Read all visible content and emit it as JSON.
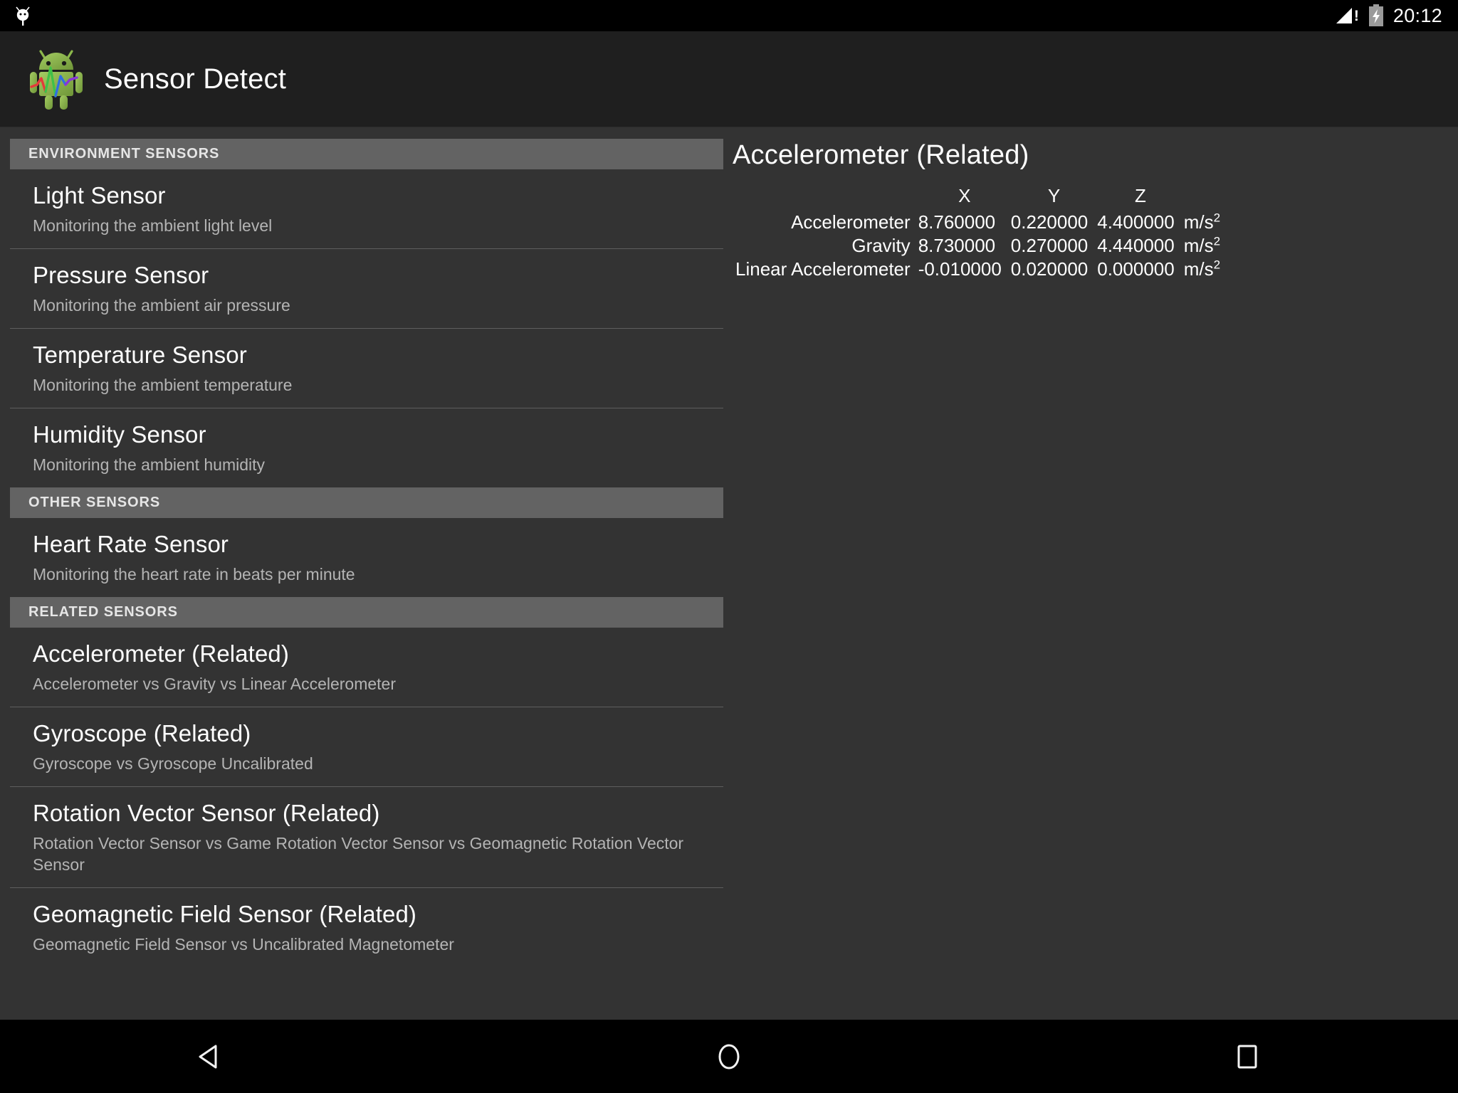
{
  "status_bar": {
    "notification_icon": "android-notification-icon",
    "signal_icon": "signal-bars-no-service-icon",
    "signal_alert": "!",
    "battery_icon": "battery-charging-icon",
    "time": "20:12"
  },
  "app_bar": {
    "icon": "android-sensor-logo-icon",
    "title": "Sensor Detect"
  },
  "colors": {
    "status_bar_bg": "#000000",
    "app_bar_bg": "#1f1f1f",
    "page_bg": "#333333",
    "section_header_bg": "#636363",
    "divider": "#5e5e5e",
    "primary_text": "#ffffff",
    "secondary_text": "#b4b4b4",
    "nav_bar_bg": "#000000",
    "robot_green": "#8cb84b"
  },
  "list": {
    "sections": [
      {
        "header": "ENVIRONMENT SENSORS",
        "items": [
          {
            "title": "Light Sensor",
            "subtitle": "Monitoring the ambient light level",
            "divider_after": true
          },
          {
            "title": "Pressure Sensor",
            "subtitle": "Monitoring the ambient air pressure",
            "divider_after": true
          },
          {
            "title": "Temperature Sensor",
            "subtitle": "Monitoring the ambient temperature",
            "divider_after": true
          },
          {
            "title": "Humidity Sensor",
            "subtitle": "Monitoring the ambient humidity",
            "divider_after": false
          }
        ]
      },
      {
        "header": "OTHER SENSORS",
        "items": [
          {
            "title": "Heart Rate Sensor",
            "subtitle": "Monitoring the heart rate in beats per minute",
            "divider_after": false
          }
        ]
      },
      {
        "header": "RELATED SENSORS",
        "items": [
          {
            "title": "Accelerometer (Related)",
            "subtitle": "Accelerometer vs Gravity vs Linear Accelerometer",
            "divider_after": true
          },
          {
            "title": "Gyroscope (Related)",
            "subtitle": "Gyroscope vs Gyroscope Uncalibrated",
            "divider_after": true
          },
          {
            "title": "Rotation Vector Sensor (Related)",
            "subtitle": "Rotation Vector Sensor vs Game Rotation Vector Sensor vs Geomagnetic Rotation Vector Sensor",
            "divider_after": true
          },
          {
            "title": "Geomagnetic Field Sensor (Related)",
            "subtitle": "Geomagnetic Field Sensor vs Uncalibrated Magnetometer",
            "divider_after": false
          }
        ]
      }
    ]
  },
  "detail": {
    "title": "Accelerometer (Related)",
    "columns": [
      "X",
      "Y",
      "Z"
    ],
    "unit": "m/s",
    "unit_exponent": "2",
    "rows": [
      {
        "label": "Accelerometer",
        "x": "8.760000",
        "y": "0.220000",
        "z": "4.400000"
      },
      {
        "label": "Gravity",
        "x": "8.730000",
        "y": "0.270000",
        "z": "4.440000"
      },
      {
        "label": "Linear Accelerometer",
        "x": "-0.010000",
        "y": "0.020000",
        "z": "0.000000"
      }
    ]
  },
  "nav_bar": {
    "back": "back-triangle-icon",
    "home": "home-circle-icon",
    "recents": "recents-square-icon"
  }
}
